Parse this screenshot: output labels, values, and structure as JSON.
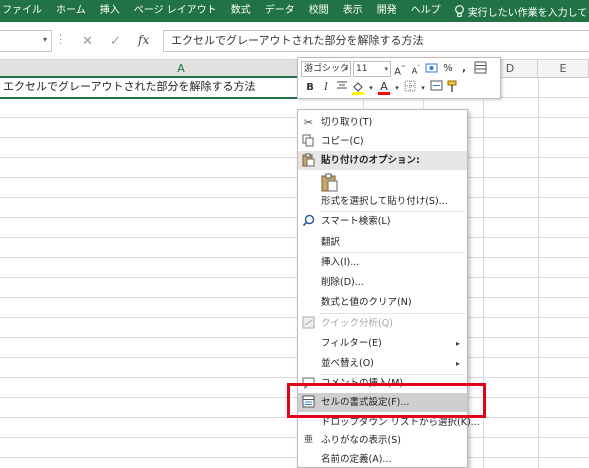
{
  "ribbon": {
    "tabs": [
      "ファイル",
      "ホーム",
      "挿入",
      "ページ レイアウト",
      "数式",
      "データ",
      "校閲",
      "表示",
      "開発",
      "ヘルプ"
    ],
    "tell_me": "実行したい作業を入力してください"
  },
  "formula_bar": {
    "name_box": "",
    "cancel_icon": "✕",
    "enter_icon": "✓",
    "fx": "fx",
    "value": "エクセルでグレーアウトされた部分を解除する方法"
  },
  "columns": [
    "A",
    "B",
    "C",
    "D",
    "E"
  ],
  "cell_a1": "エクセルでグレーアウトされた部分を解除する方法",
  "mini_toolbar": {
    "font": "游ゴシック",
    "size": "11",
    "grow": "A",
    "shrink": "A",
    "percent": "%",
    "comma": ",",
    "bold": "B",
    "italic": "I",
    "font_color_letter": "A",
    "fill_color": "#ffff00",
    "font_color": "#ff0000"
  },
  "context_menu": {
    "items": [
      {
        "label": "切り取り(T)",
        "icon": "scissors-icon"
      },
      {
        "label": "コピー(C)",
        "icon": "copy-icon"
      },
      {
        "label": "貼り付けのオプション:",
        "icon": "paste-icon"
      },
      {
        "label": "形式を選択して貼り付け(S)..."
      },
      {
        "label": "スマート検索(L)",
        "icon": "search-icon"
      },
      {
        "label": "翻訳"
      },
      {
        "label": "挿入(I)..."
      },
      {
        "label": "削除(D)..."
      },
      {
        "label": "数式と値のクリア(N)"
      },
      {
        "label": "クイック分析(Q)",
        "icon": "quick-analysis-icon"
      },
      {
        "label": "フィルター(E)"
      },
      {
        "label": "並べ替え(O)"
      },
      {
        "label": "コメントの挿入(M)",
        "icon": "comment-icon"
      },
      {
        "label": "セルの書式設定(F)...",
        "icon": "format-cells-icon"
      },
      {
        "label": "ドロップダウン リストから選択(K)..."
      },
      {
        "label": "ふりがなの表示(S)",
        "icon": "furigana-icon"
      },
      {
        "label": "名前の定義(A)..."
      }
    ],
    "submenu_arrow": "▸"
  },
  "colors": {
    "ribbon": "#217346",
    "highlight_box": "#e3001b"
  }
}
